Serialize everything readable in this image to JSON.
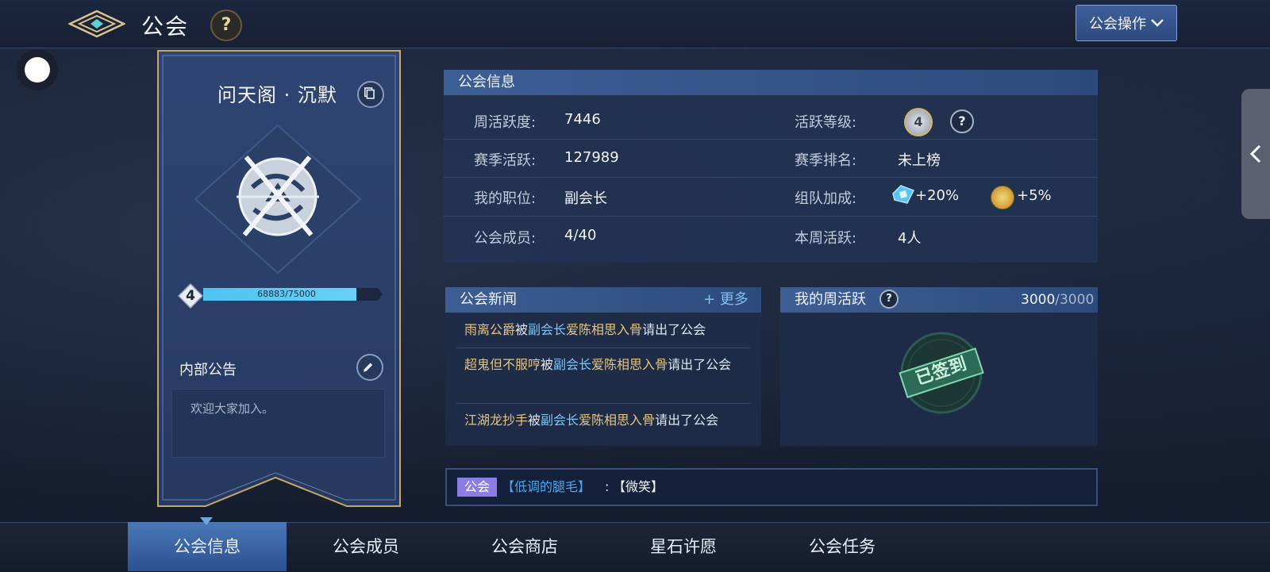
{
  "header": {
    "title": "公会",
    "help": "?",
    "ops_button": "公会操作"
  },
  "guild": {
    "name": "问天阁 · 沉默",
    "level": "4",
    "xp_text": "68883/75000",
    "xp_progress": 0.918,
    "notice_title": "内部公告",
    "notice_text": "欢迎大家加入。"
  },
  "info": {
    "title": "公会信息",
    "rows": [
      {
        "label": "周活跃度:",
        "value": "7446",
        "label2": "活跃等级:",
        "value2": "4"
      },
      {
        "label": "赛季活跃:",
        "value": "127989",
        "label2": "赛季排名:",
        "value2": "未上榜"
      },
      {
        "label": "我的职位:",
        "value": "副会长",
        "label2": "组队加成:",
        "bonus1": "+20%",
        "bonus2": "+5%"
      },
      {
        "label": "公会成员:",
        "value": "4/40",
        "label2": "本周活跃:",
        "value2": "4人"
      }
    ]
  },
  "news": {
    "title": "公会新闻",
    "more": "更多",
    "items": [
      {
        "name": "雨离公爵",
        "mid": "被",
        "role": "副会长",
        "actor": "爱陈相思入骨",
        "end": "请出了公会"
      },
      {
        "name": "超鬼但不服哼",
        "mid": "被",
        "role": "副会长",
        "actor": "爱陈相思入骨",
        "end": "请出了公会"
      },
      {
        "name": "江湖龙抄手",
        "mid": "被",
        "role": "副会长",
        "actor": "爱陈相思入骨",
        "end": "请出了公会"
      }
    ]
  },
  "weekly": {
    "title": "我的周活跃",
    "help": "?",
    "score_current": "3000",
    "score_total": "/3000",
    "stamp_text": "已签到"
  },
  "chat": {
    "channel": "公会",
    "speaker": "【低调的腿毛】",
    "separator": ":",
    "message": "【微笑】"
  },
  "tabs": [
    "公会信息",
    "公会成员",
    "公会商店",
    "星石许愿",
    "公会任务"
  ],
  "colors": {
    "accent_blue": "#4ec3f0",
    "gold_text": "#e8c47a",
    "role_blue": "#7fc4f2",
    "chat_tag": "#8b7de6"
  }
}
